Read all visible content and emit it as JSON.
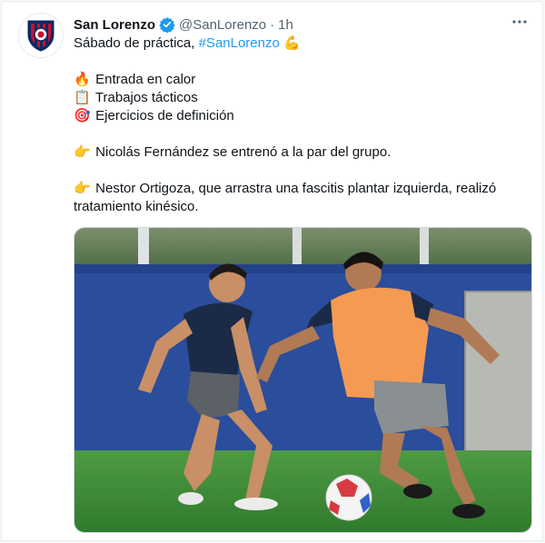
{
  "account": {
    "name": "San Lorenzo",
    "handle": "@SanLorenzo",
    "separator": "·",
    "time": "1h",
    "verified": true
  },
  "tweet": {
    "line1_text": "Sábado de práctica, ",
    "line1_hashtag": "#SanLorenzo",
    "line1_emoji": "💪",
    "items": [
      {
        "emoji": "🔥",
        "text": "Entrada en calor"
      },
      {
        "emoji": "📋",
        "text": "Trabajos tácticos"
      },
      {
        "emoji": "🎯",
        "text": "Ejercicios de definición"
      }
    ],
    "note1_emoji": "👉",
    "note1_text": "Nicolás Fernández se entrenó a la par del grupo.",
    "note2_emoji": "👉",
    "note2_text": "Nestor Ortigoza, que arrastra una fascitis plantar izquierda, realizó tratamiento kinésico."
  },
  "media": {
    "icon": "photo-training-icon",
    "colors": {
      "wall": "#2a4d9c",
      "grass": "#3f8c3a",
      "bib": "#f59a52",
      "shirt": "#1b2a47"
    }
  },
  "icons": {
    "verified": "verified-badge-icon",
    "more": "more-options-icon",
    "avatar": "club-crest-icon"
  },
  "colors": {
    "link": "#1d9bf0",
    "secondary_text": "#536471",
    "primary_text": "#0f1419"
  }
}
